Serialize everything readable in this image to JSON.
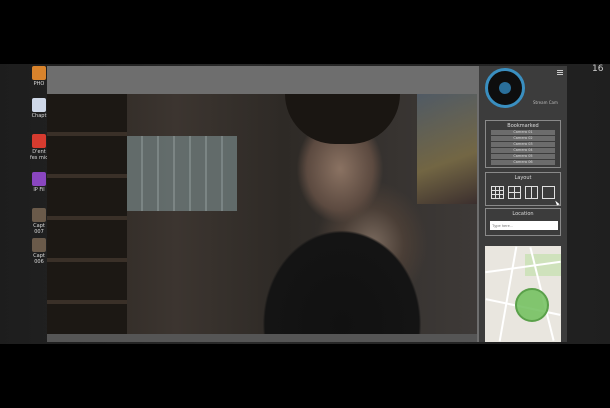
{
  "clock": "16",
  "desktop_icons": [
    {
      "label": "PHO",
      "icon": "folder-icon",
      "color": "#d8832c"
    },
    {
      "label": "Chapt",
      "icon": "document-icon",
      "color": "#cfd8e8"
    },
    {
      "label": "D'ent\nfes mic",
      "icon": "pdf-icon",
      "color": "#d63b2f"
    },
    {
      "label": "IP Fil",
      "icon": "app-icon",
      "color": "#8a46c0"
    },
    {
      "label": "Capt\n007",
      "icon": "image-icon",
      "color": "#6a5a4a"
    },
    {
      "label": "Capt\n006",
      "icon": "image-icon",
      "color": "#6a5a4a"
    }
  ],
  "panel": {
    "brand": "Stream Cam",
    "bookmarked_title": "Bookmarked",
    "bookmarks": [
      "Camera 01",
      "Camera 02",
      "Camera 03",
      "Camera 04",
      "Camera 05",
      "Camera 06"
    ],
    "layout_title": "Layout",
    "layouts": [
      "grid-3x3",
      "grid-2x2",
      "grid-1x2",
      "single"
    ],
    "location_title": "Location",
    "location_placeholder": "Type here..."
  },
  "colors": {
    "accent": "#3a8fc0",
    "panel_bg": "#3c3c3c",
    "window_bg": "#6e6e6e",
    "geofence": "#6ebe5a"
  }
}
